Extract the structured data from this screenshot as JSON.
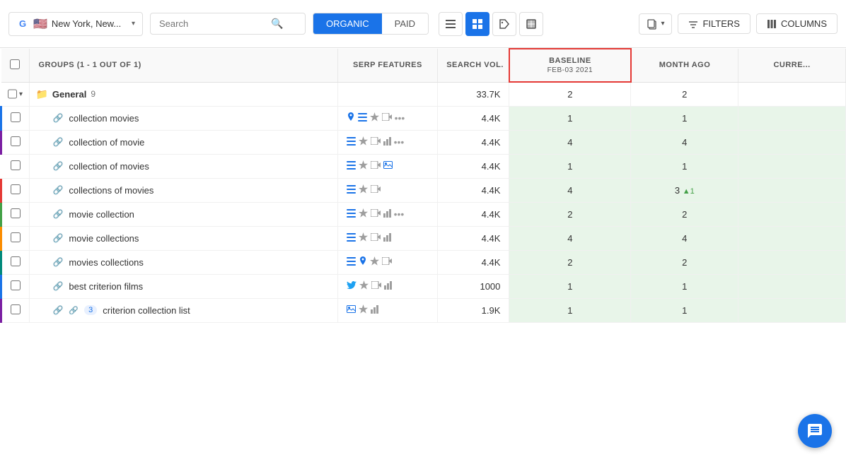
{
  "header": {
    "location": "New York, New...",
    "search_placeholder": "Search",
    "tabs": [
      {
        "label": "ORGANIC",
        "active": true
      },
      {
        "label": "PAID",
        "active": false
      }
    ],
    "view_buttons": [
      {
        "id": "list",
        "icon": "☰",
        "active": false
      },
      {
        "id": "grid",
        "icon": "⊞",
        "active": true
      },
      {
        "id": "tag",
        "icon": "◇",
        "active": false
      },
      {
        "id": "image",
        "icon": "▣",
        "active": false
      }
    ],
    "actions": {
      "copy_label": "",
      "filters_label": "FILTERS",
      "columns_label": "COLUMNS"
    }
  },
  "table": {
    "columns": [
      {
        "id": "check",
        "label": ""
      },
      {
        "id": "groups",
        "label": "GROUPS (1 - 1 OUT OF 1)"
      },
      {
        "id": "serp",
        "label": "SERP FEATURES"
      },
      {
        "id": "vol",
        "label": "SEARCH VOL."
      },
      {
        "id": "baseline",
        "label": "BASELINE",
        "sub": "FEB-03 2021",
        "highlighted": true
      },
      {
        "id": "month",
        "label": "MONTH AGO"
      },
      {
        "id": "current",
        "label": "CURRE..."
      }
    ],
    "group": {
      "name": "General",
      "count": 9,
      "vol": "33.7K",
      "baseline": 2,
      "month_ago": 2,
      "current": ""
    },
    "rows": [
      {
        "id": 1,
        "keyword": "collection movies",
        "link_icon": true,
        "badge": null,
        "serp": [
          "pin",
          "list",
          "star",
          "video",
          "more"
        ],
        "vol": "4.4K",
        "baseline": 1,
        "month_ago": 1,
        "current": "",
        "color": "blue"
      },
      {
        "id": 2,
        "keyword": "collection of movie",
        "link_icon": true,
        "badge": null,
        "serp": [
          "list",
          "star",
          "video",
          "bar",
          "more"
        ],
        "vol": "4.4K",
        "baseline": 4,
        "month_ago": 4,
        "current": "",
        "color": "purple"
      },
      {
        "id": 3,
        "keyword": "collection of movies",
        "link_icon": true,
        "badge": null,
        "serp": [
          "list",
          "star",
          "video",
          "image"
        ],
        "vol": "4.4K",
        "baseline": 1,
        "month_ago": 1,
        "current": "",
        "color": "none"
      },
      {
        "id": 4,
        "keyword": "collections of movies",
        "link_icon": true,
        "badge": null,
        "serp": [
          "list",
          "star",
          "video"
        ],
        "vol": "4.4K",
        "baseline": 4,
        "month_ago": "3 ▲1",
        "month_change": true,
        "current": "",
        "color": "red"
      },
      {
        "id": 5,
        "keyword": "movie collection",
        "link_icon": true,
        "badge": null,
        "serp": [
          "list",
          "star",
          "video",
          "bar",
          "more"
        ],
        "vol": "4.4K",
        "baseline": 2,
        "month_ago": 2,
        "current": "",
        "color": "green"
      },
      {
        "id": 6,
        "keyword": "movie collections",
        "link_icon": true,
        "badge": null,
        "serp": [
          "list",
          "star",
          "video",
          "bar"
        ],
        "vol": "4.4K",
        "baseline": 4,
        "month_ago": 4,
        "current": "",
        "color": "orange"
      },
      {
        "id": 7,
        "keyword": "movies collections",
        "link_icon": true,
        "badge": null,
        "serp": [
          "list",
          "pin",
          "star",
          "video"
        ],
        "vol": "4.4K",
        "baseline": 2,
        "month_ago": 2,
        "current": "",
        "color": "teal"
      },
      {
        "id": 8,
        "keyword": "best criterion films",
        "link_icon": true,
        "badge": null,
        "serp": [
          "twitter",
          "star",
          "video",
          "bar"
        ],
        "vol": "1000",
        "baseline": 1,
        "month_ago": 1,
        "current": "",
        "color": "blue"
      },
      {
        "id": 9,
        "keyword": "criterion collection list",
        "link_icon": true,
        "badge": "3",
        "serp": [
          "image",
          "star",
          "bar"
        ],
        "vol": "1.9K",
        "baseline": 1,
        "month_ago": 1,
        "current": "",
        "color": "purple"
      }
    ]
  },
  "chat_icon": "💬"
}
